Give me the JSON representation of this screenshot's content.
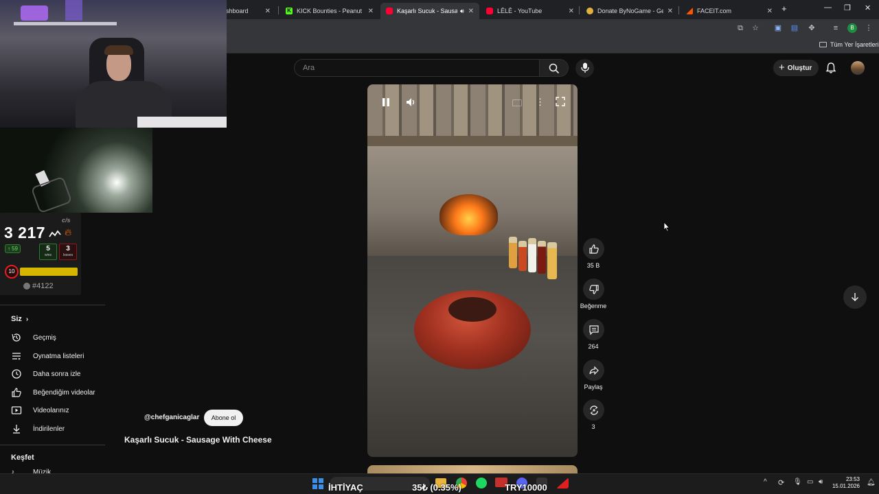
{
  "browser": {
    "tabs": [
      {
        "title": "Kick Dashboard",
        "favicon_color": "#53fc18"
      },
      {
        "title": "KICK Bounties - Peanut Butt",
        "favicon_color": "#53fc18"
      },
      {
        "title": "Kaşarlı Sucuk - Sausage",
        "favicon_color": "#ff0033"
      },
      {
        "title": "LÊLÊ - YouTube",
        "favicon_color": "#ff0033"
      },
      {
        "title": "Donate ByNoGame - Gelen",
        "favicon_color": "#e0b040"
      },
      {
        "title": "FACEIT.com",
        "favicon_color": "#ff5500"
      }
    ],
    "bookmarks_label": "Tüm Yer İşaretleri",
    "profile_initial": "B"
  },
  "youtube": {
    "search_placeholder": "Ara",
    "create_label": "Oluştur"
  },
  "faceit": {
    "elo": "3 217",
    "gain": "59",
    "wins": "5",
    "wins_label": "wins",
    "losses": "3",
    "losses_label": "losses",
    "level": "10",
    "rank": "#4122",
    "brand": "c/s"
  },
  "sidebar": {
    "you_label": "Siz",
    "items": [
      {
        "label": "Geçmiş",
        "icon": "history-icon"
      },
      {
        "label": "Oynatma listeleri",
        "icon": "playlist-icon"
      },
      {
        "label": "Daha sonra izle",
        "icon": "clock-icon"
      },
      {
        "label": "Beğendiğim videolar",
        "icon": "like-icon"
      },
      {
        "label": "Videolarınız",
        "icon": "video-icon"
      },
      {
        "label": "İndirilenler",
        "icon": "download-icon"
      }
    ],
    "explore_label": "Keşfet",
    "partial_item": "Müzik"
  },
  "short": {
    "channel": "@chefganicaglar",
    "subscribe_label": "Abone ol",
    "title": "Kaşarlı Sucuk - Sausage With Cheese",
    "likes": "35 B",
    "dislike_label": "Beğenme",
    "comments": "264",
    "share_label": "Paylaş",
    "remix": "3"
  },
  "taskbar": {
    "ticker": [
      {
        "text": "İHTİYAÇ"
      },
      {
        "text": "35₺ (0.35%)"
      },
      {
        "text": "TRY10000"
      }
    ],
    "time": "23:53",
    "date": "15.01.2026"
  }
}
